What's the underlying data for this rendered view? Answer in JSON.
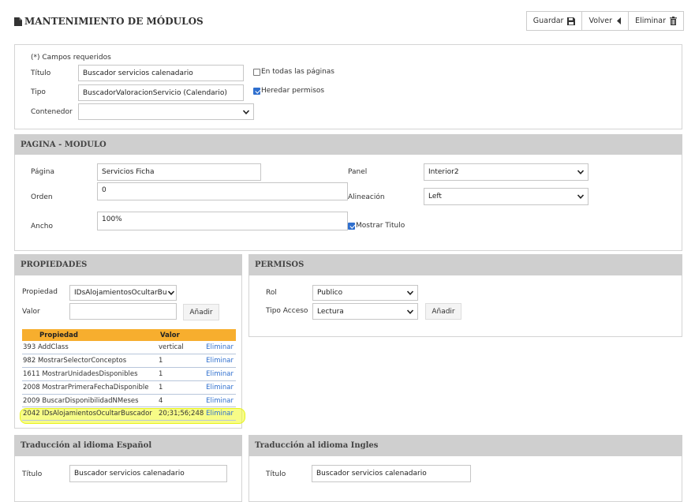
{
  "header": {
    "title": "MANTENIMIENTO DE MÓDULOS",
    "buttons": {
      "save": "Guardar",
      "back": "Volver",
      "delete": "Eliminar"
    }
  },
  "module_form": {
    "required_note": "(*) Campos requeridos",
    "titulo_label": "Título",
    "titulo_value": "Buscador servicios calenadario",
    "tipo_label": "Tipo",
    "tipo_value": "BuscadorValoracionServicio (Calendario)",
    "contenedor_label": "Contenedor",
    "contenedor_value": "",
    "all_pages_label": "En todas las páginas",
    "all_pages_checked": false,
    "inherit_label": "Heredar permisos",
    "inherit_checked": true
  },
  "pagina_modulo": {
    "heading": "PAGINA - MODULO",
    "pagina_label": "Página",
    "pagina_value": "Servicios Ficha",
    "orden_label": "Orden",
    "orden_value": "0",
    "ancho_label": "Ancho",
    "ancho_value": "100%",
    "panel_label": "Panel",
    "panel_value": "Interior2",
    "alineacion_label": "Alineación",
    "alineacion_value": "Left",
    "show_title_label": "Mostrar Titulo",
    "show_title_checked": true
  },
  "propiedades": {
    "heading": "PROPIEDADES",
    "propiedad_label": "Propiedad",
    "propiedad_value": "IDsAlojamientosOcultarBu",
    "valor_label": "Valor",
    "valor_value": "",
    "add_label": "Añadir",
    "table_headers": [
      "Propiedad",
      "Valor"
    ],
    "rows": [
      {
        "id": "393",
        "name": "AddClass",
        "value": "vertical",
        "action": "Eliminar"
      },
      {
        "id": "982",
        "name": "MostrarSelectorConceptos",
        "value": "1",
        "action": "Eliminar"
      },
      {
        "id": "1611",
        "name": "MostrarUnidadesDisponibles",
        "value": "1",
        "action": "Eliminar"
      },
      {
        "id": "2008",
        "name": "MostrarPrimeraFechaDisponible",
        "value": "1",
        "action": "Eliminar"
      },
      {
        "id": "2009",
        "name": "BuscarDisponibilidadNMeses",
        "value": "4",
        "action": "Eliminar"
      },
      {
        "id": "2042",
        "name": "IDsAlojamientosOcultarBuscador",
        "value": "20;31;56;248",
        "action": "Eliminar"
      }
    ]
  },
  "permisos": {
    "heading": "PERMISOS",
    "rol_label": "Rol",
    "rol_value": "Publico",
    "tipo_acceso_label": "Tipo Acceso",
    "tipo_acceso_value": "Lectura",
    "add_label": "Añadir"
  },
  "traduccion_es": {
    "heading": "Traducción al idioma Español",
    "titulo_label": "Título",
    "titulo_value": "Buscador servicios calenadario"
  },
  "traduccion_en": {
    "heading": "Traducción al idioma Ingles",
    "titulo_label": "Título",
    "titulo_value": "Buscador servicios calenadario"
  },
  "colors": {
    "table_header": "#f7ae2e",
    "link": "#2f6fce",
    "panel_header": "#cfcfcf",
    "highlight": "#f1fa25"
  }
}
